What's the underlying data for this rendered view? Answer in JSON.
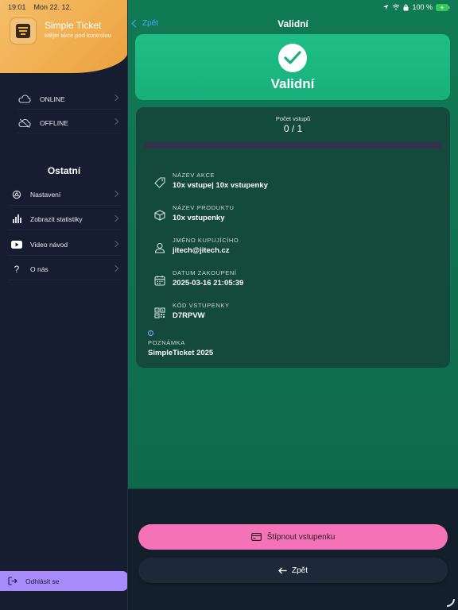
{
  "status_bar": {
    "time": "19:01",
    "date": "Mon 22. 12.",
    "battery": "100 %"
  },
  "sidebar": {
    "app_title": "Simple Ticket",
    "app_subtitle": "Mějte akce pod kontrolou",
    "modes": [
      {
        "label": "ONLINE",
        "icon": "cloud-icon"
      },
      {
        "label": "OFFLINE",
        "icon": "cloud-off-icon"
      }
    ],
    "section_title": "Ostatní",
    "menu": [
      {
        "label": "Nastavení",
        "icon": "settings-icon"
      },
      {
        "label": "Zobrazit statistiky",
        "icon": "bar-chart-icon"
      },
      {
        "label": "Video návod",
        "icon": "youtube-icon"
      },
      {
        "label": "O nás",
        "icon": "question-icon"
      }
    ],
    "logout_label": "Odhlásit se"
  },
  "header": {
    "back_label": "Zpět",
    "title": "Validní"
  },
  "status_card": {
    "label": "Validní",
    "color": "#1fbe86"
  },
  "ticket": {
    "count_label": "Počet vstupů",
    "count_value": "0 / 1",
    "progress": 0,
    "fields": [
      {
        "label": "NÁZEV AKCE",
        "value": "10x vstupe| 10x vstupenky",
        "icon": "tag-icon"
      },
      {
        "label": "NÁZEV PRODUKTU",
        "value": "10x vstupenky",
        "icon": "box-icon"
      },
      {
        "label": "JMÉNO KUPUJÍCÍHO",
        "value": "jitech@jitech.cz",
        "icon": "user-icon"
      },
      {
        "label": "DATUM ZAKOUPENÍ",
        "value": "2025-03-16 21:05:39",
        "icon": "calendar-icon"
      },
      {
        "label": "KÓD VSTUPENKY",
        "value": "D7RPVW",
        "icon": "qr-code-icon"
      }
    ],
    "note_label": "POZNÁMKA",
    "note_value": "SimpleTicket 2025"
  },
  "actions": {
    "stamp_label": "Štípnout vstupenku",
    "back_label": "Zpět"
  },
  "colors": {
    "accent_purple": "#a78bfa",
    "accent_pink": "#f472b6",
    "accent_orange": "#f0ad4e",
    "link_blue": "#4aa8ff"
  }
}
